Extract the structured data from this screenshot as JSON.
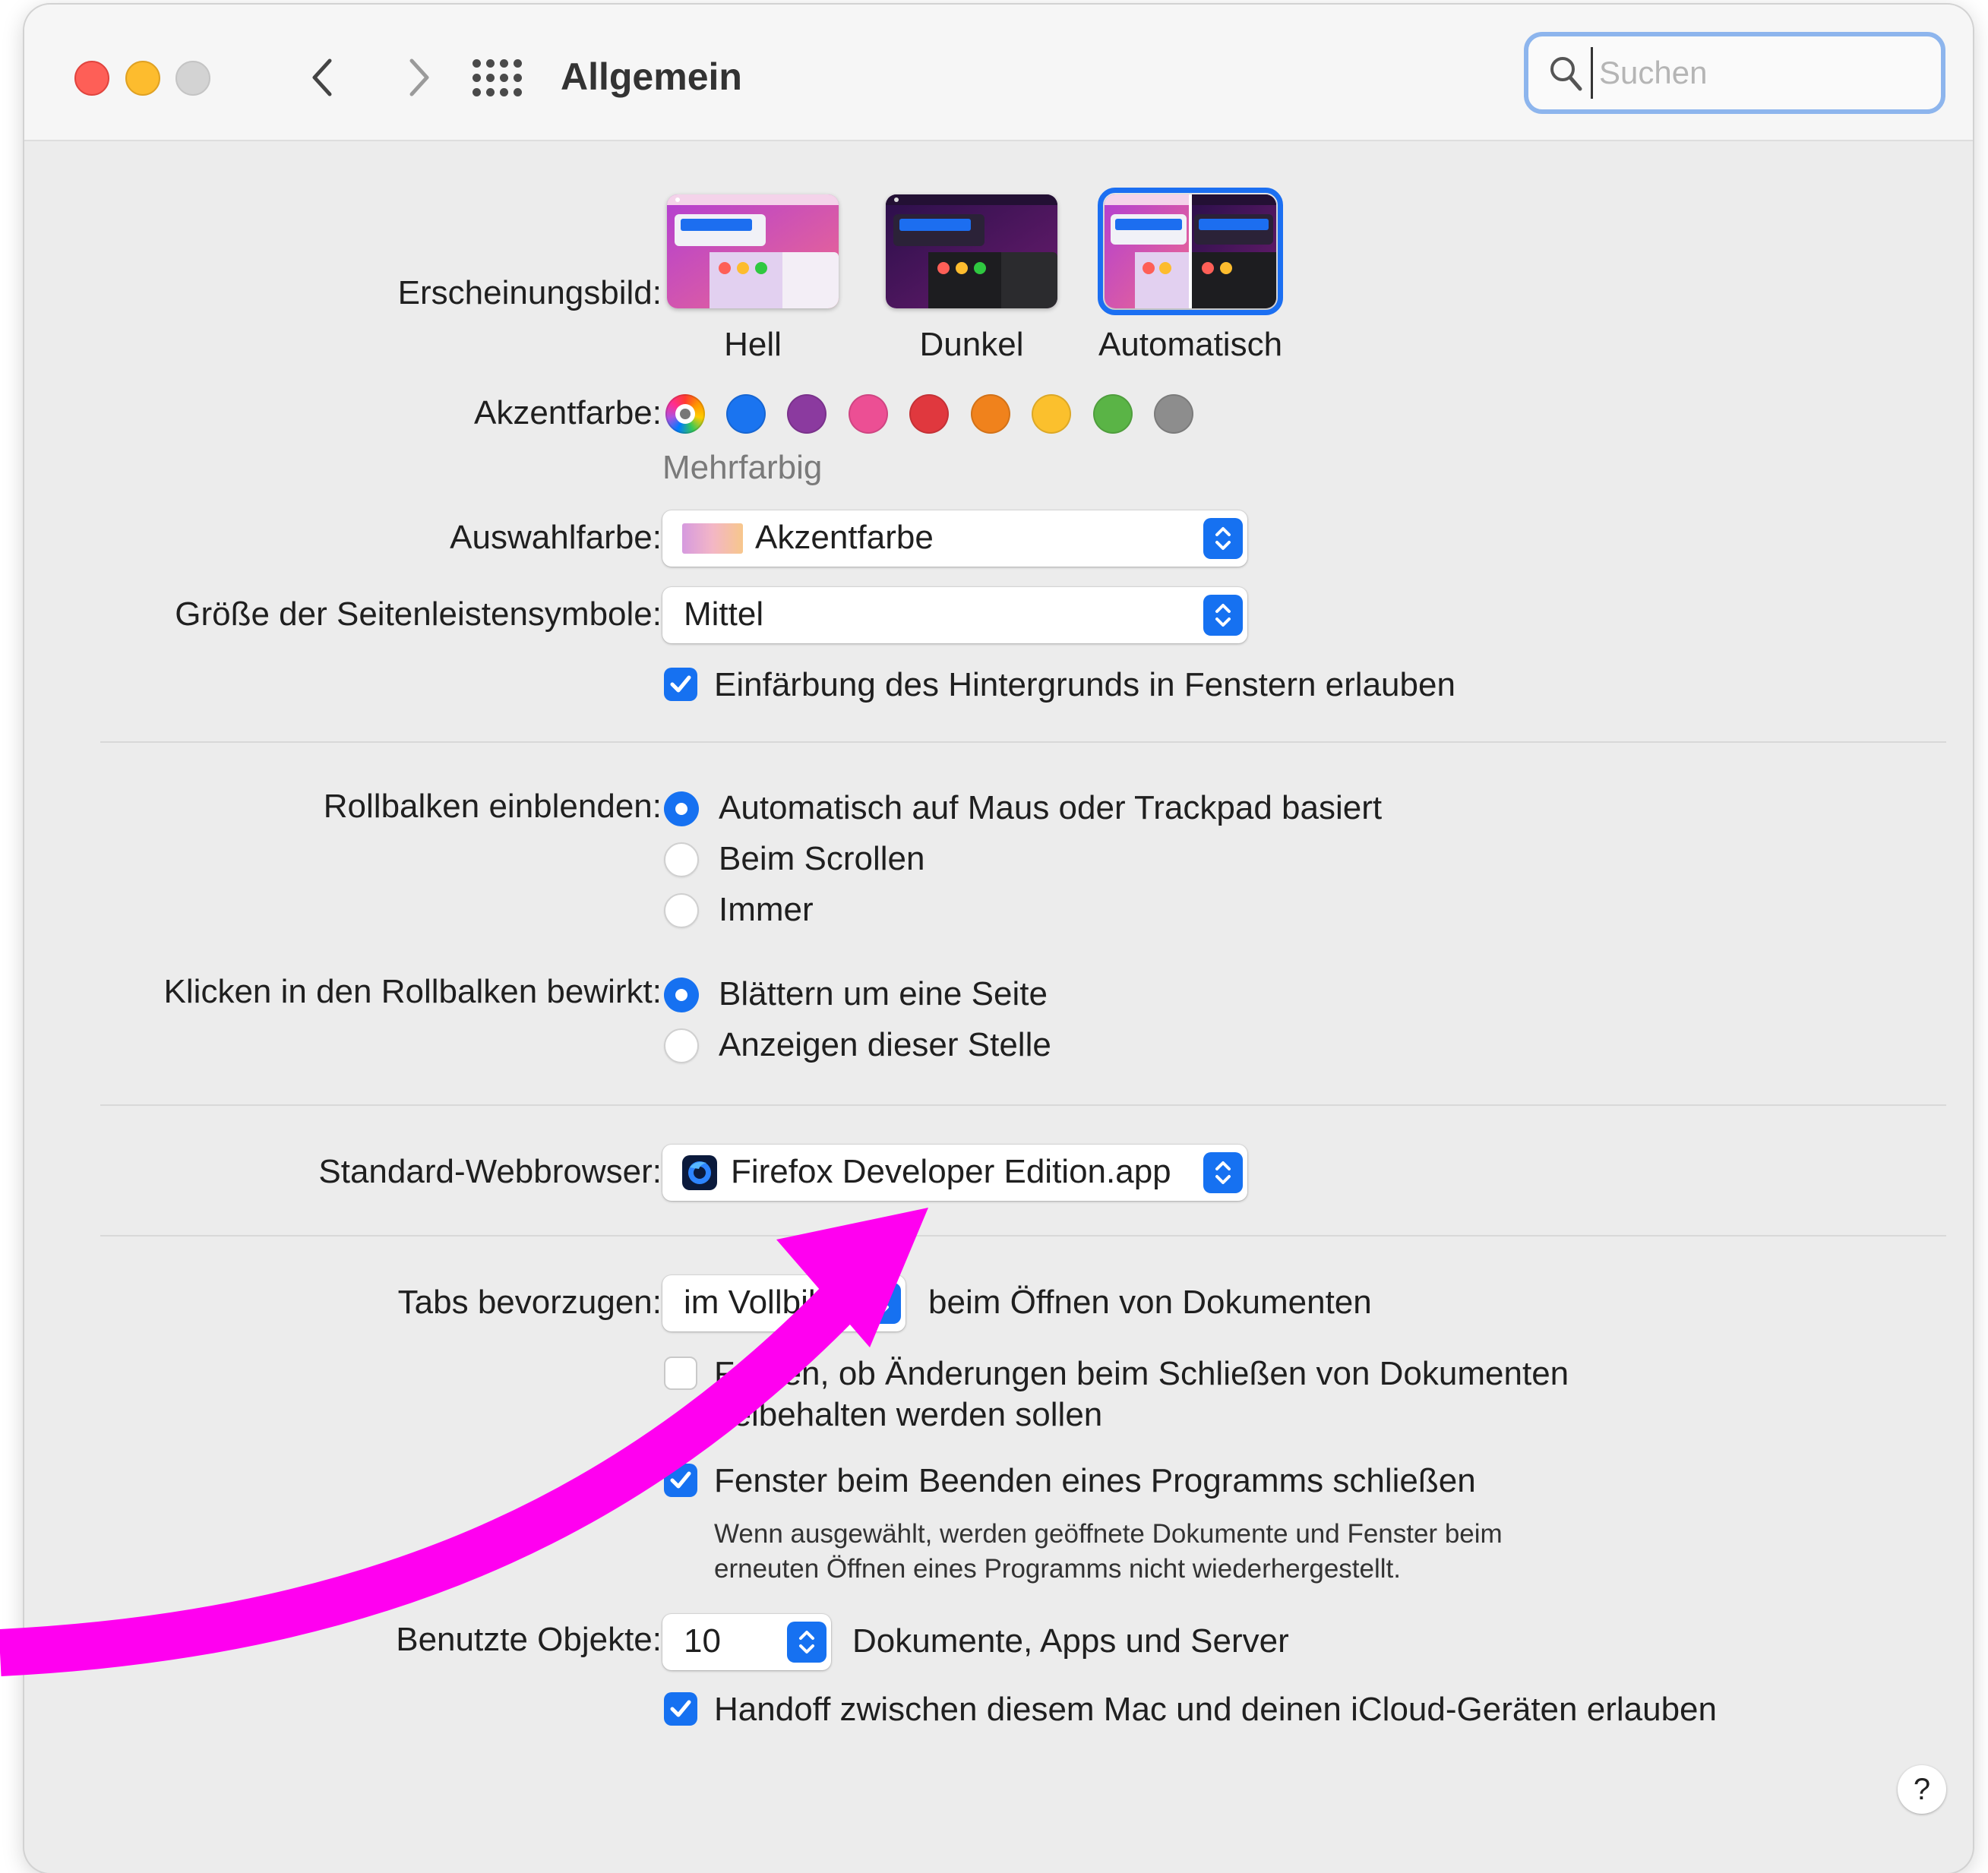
{
  "window": {
    "title": "Allgemein",
    "search_placeholder": "Suchen"
  },
  "appearance": {
    "label": "Erscheinungsbild:",
    "options": [
      {
        "label": "Hell",
        "selected": false
      },
      {
        "label": "Dunkel",
        "selected": false
      },
      {
        "label": "Automatisch",
        "selected": true
      }
    ]
  },
  "accent": {
    "label": "Akzentfarbe:",
    "selected_caption": "Mehrfarbig",
    "colors": [
      "multicolor",
      "#1a74f0",
      "#8b3a9f",
      "#ec4f94",
      "#e0383e",
      "#f0821c",
      "#fbc02d",
      "#5ab446",
      "#8d8d8d"
    ]
  },
  "highlight": {
    "label": "Auswahlfarbe:",
    "value": "Akzentfarbe"
  },
  "sidebar_icon_size": {
    "label": "Größe der Seitenleistensymbole:",
    "value": "Mittel"
  },
  "wallpaper_tinting": {
    "label": "Einfärbung des Hintergrunds in Fenstern erlauben",
    "checked": true
  },
  "show_scrollbars": {
    "label": "Rollbalken einblenden:",
    "options": [
      {
        "label": "Automatisch auf Maus oder Trackpad basiert",
        "selected": true
      },
      {
        "label": "Beim Scrollen",
        "selected": false
      },
      {
        "label": "Immer",
        "selected": false
      }
    ]
  },
  "click_scrollbar": {
    "label": "Klicken in den Rollbalken bewirkt:",
    "options": [
      {
        "label": "Blättern um eine Seite",
        "selected": true
      },
      {
        "label": "Anzeigen dieser Stelle",
        "selected": false
      }
    ]
  },
  "default_browser": {
    "label": "Standard-Webbrowser:",
    "value": "Firefox Developer Edition.app"
  },
  "prefer_tabs": {
    "label": "Tabs bevorzugen:",
    "value": "im Vollbild",
    "suffix": "beim Öffnen von Dokumenten"
  },
  "ask_keep_changes": {
    "label_line1": "Fragen, ob Änderungen beim Schließen von Dokumenten",
    "label_line2": "beibehalten werden sollen",
    "checked": false
  },
  "close_windows": {
    "label": "Fenster beim Beenden eines Programms schließen",
    "checked": true,
    "note_line1": "Wenn ausgewählt, werden geöffnete Dokumente und Fenster beim",
    "note_line2": "erneuten Öffnen eines Programms nicht wiederhergestellt."
  },
  "recent_items": {
    "label": "Benutzte Objekte:",
    "value": "10",
    "suffix": "Dokumente, Apps und Server"
  },
  "handoff": {
    "label": "Handoff zwischen diesem Mac und deinen iCloud-Geräten erlauben",
    "checked": true
  },
  "help": {
    "label": "?"
  },
  "annotation": {
    "color": "#ff00f0",
    "icon": "magenta-arrow-icon"
  }
}
